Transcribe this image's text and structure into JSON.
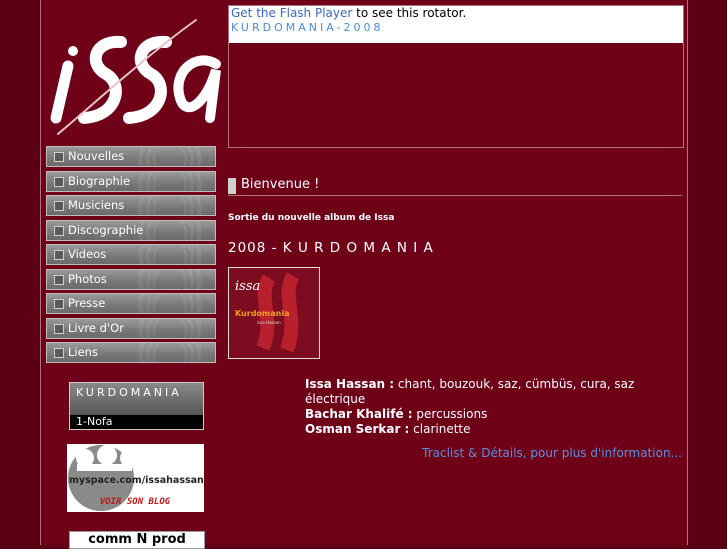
{
  "brand": {
    "logo_text": "issa"
  },
  "nav": {
    "items": [
      {
        "label": "Nouvelles"
      },
      {
        "label": "Biographie"
      },
      {
        "label": "Musiciens"
      },
      {
        "label": "Discographie"
      },
      {
        "label": "Videos"
      },
      {
        "label": "Photos"
      },
      {
        "label": "Presse"
      },
      {
        "label": "Livre d'Or"
      },
      {
        "label": "Liens"
      }
    ]
  },
  "player": {
    "title": "KURDOMANIA",
    "track": "1-Nofa"
  },
  "myspace": {
    "url_text": "myspace.com/issahassan",
    "blog_text": "VOIR SON BLOG"
  },
  "commnprod": {
    "label": "comm N prod"
  },
  "rotator": {
    "link_text": "Get the Flash Player",
    "rest_text": " to see this rotator.",
    "caption": "KURDOMANIA-2008"
  },
  "main": {
    "welcome": "Bienvenue !",
    "subtitle": "Sortie du nouvelle album de Issa",
    "album_title": "2008 - K U R D O M A N I A",
    "cover": {
      "logo": "issa",
      "title": "Kurdomania",
      "small": "Issa Hassan"
    },
    "credits": [
      {
        "name": "Issa Hassan :",
        "role": " chant, bouzouk, saz, cümbüs, cura, saz électrique"
      },
      {
        "name": "Bachar Khalifé :",
        "role": " percussions"
      },
      {
        "name": "Osman Serkar :",
        "role": " clarinette"
      }
    ],
    "link": "Traclist & Détails, pour plus d'information..."
  },
  "colors": {
    "background": "#5a0012",
    "page": "#6e0018",
    "link": "#5b8fe0"
  }
}
